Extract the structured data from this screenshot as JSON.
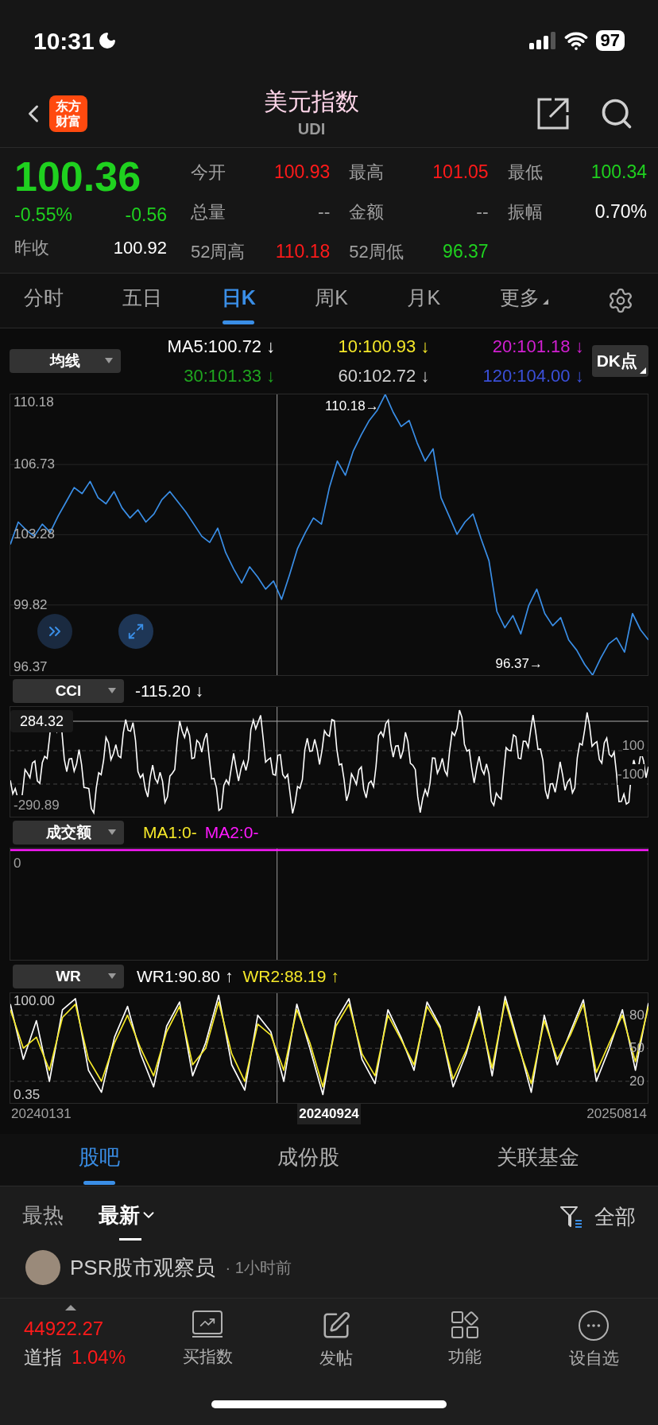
{
  "status_bar": {
    "time": "10:31",
    "battery": "97"
  },
  "nav": {
    "title": "美元指数",
    "code": "UDI",
    "logo": [
      "东方",
      "财富"
    ]
  },
  "quote": {
    "price": "100.36",
    "change_pct": "-0.55%",
    "change": "-0.56",
    "prev_close_label": "昨收",
    "prev_close": "100.92",
    "stats": [
      {
        "label": "今开",
        "value": "100.93",
        "color": "#ff1a1a"
      },
      {
        "label": "最高",
        "value": "101.05",
        "color": "#ff1a1a"
      },
      {
        "label": "最低",
        "value": "100.34",
        "color": "#1fd11f"
      },
      {
        "label": "总量",
        "value": "--",
        "color": "#9a9a9a"
      },
      {
        "label": "金额",
        "value": "--",
        "color": "#9a9a9a"
      },
      {
        "label": "振幅",
        "value": "0.70%",
        "color": "#ffffff"
      },
      {
        "label": "52周高",
        "value": "110.18",
        "color": "#ff1a1a"
      },
      {
        "label": "52周低",
        "value": "96.37",
        "color": "#1fd11f"
      }
    ]
  },
  "period_tabs": [
    {
      "label": "分时",
      "selected": false,
      "kind": "tab"
    },
    {
      "label": "五日",
      "selected": false,
      "kind": "tab"
    },
    {
      "label": "日K",
      "selected": true,
      "kind": "tab"
    },
    {
      "label": "周K",
      "selected": false,
      "kind": "tab"
    },
    {
      "label": "月K",
      "selected": false,
      "kind": "tab"
    },
    {
      "label": "更多",
      "selected": false,
      "kind": "menu"
    }
  ],
  "ma_selector": "均线",
  "ma_values": [
    {
      "text": "MA5:100.72 ↓",
      "color": "#ffffff"
    },
    {
      "text": "10:100.93 ↓",
      "color": "#f5e829"
    },
    {
      "text": "20:101.18 ↓",
      "color": "#d21fd2"
    },
    {
      "text": "30:101.33 ↓",
      "color": "#1fa51f"
    },
    {
      "text": "60:102.72 ↓",
      "color": "#d0d0d0"
    },
    {
      "text": "120:104.00 ↓",
      "color": "#3a4fd8"
    }
  ],
  "dk_button": "DK点",
  "price_chart": {
    "high_marker": "110.18→",
    "low_marker": "96.37→",
    "chart_data": {
      "type": "line",
      "grid": true,
      "ylim": [
        96.37,
        110.18
      ],
      "yticks": [
        {
          "value": 110.18,
          "label": "110.18"
        },
        {
          "value": 106.73,
          "label": "106.73"
        },
        {
          "value": 103.28,
          "label": "103.28"
        },
        {
          "value": 99.82,
          "label": "99.82"
        },
        {
          "value": 96.37,
          "label": "96.37"
        }
      ],
      "series": [
        {
          "color": "#3a8ee6",
          "values": [
            102.8,
            103.9,
            103.5,
            103.2,
            103.8,
            103.4,
            104.2,
            104.9,
            105.6,
            105.3,
            105.9,
            105.1,
            104.8,
            105.4,
            104.6,
            104.1,
            104.5,
            103.9,
            104.3,
            105.0,
            105.4,
            104.9,
            104.4,
            103.8,
            103.2,
            102.9,
            103.6,
            102.4,
            101.6,
            100.9,
            101.7,
            101.2,
            100.6,
            101.0,
            100.1,
            101.3,
            102.6,
            103.4,
            104.1,
            103.8,
            105.6,
            106.9,
            106.2,
            107.4,
            108.2,
            108.9,
            109.4,
            110.18,
            109.3,
            108.6,
            108.9,
            107.8,
            106.9,
            107.5,
            105.1,
            104.2,
            103.3,
            103.9,
            104.3,
            103.1,
            102.0,
            99.5,
            98.7,
            99.3,
            98.4,
            99.8,
            100.6,
            99.4,
            98.8,
            99.2,
            98.1,
            97.6,
            96.9,
            96.37,
            97.2,
            97.9,
            98.2,
            97.5,
            99.4,
            98.6,
            98.1
          ]
        }
      ]
    }
  },
  "cci": {
    "selector": "CCI",
    "value": "-115.20 ↓",
    "max_label": "284.32",
    "min_label": "-290.89",
    "right_labels": [
      "100",
      "-100"
    ]
  },
  "volume": {
    "selector": "成交额",
    "ma_values": [
      {
        "text": "MA1:0-",
        "color": "#f5e829"
      },
      {
        "text": "MA2:0-",
        "color": "#ff19ff"
      }
    ],
    "axis_label": "0"
  },
  "wr": {
    "selector": "WR",
    "values": [
      {
        "text": "WR1:90.80 ↑",
        "color": "#ffffff"
      },
      {
        "text": "WR2:88.19 ↑",
        "color": "#f5e829"
      }
    ],
    "max_label": "100.00",
    "min_label": "0.35",
    "chart_data": {
      "type": "line",
      "grid": true,
      "ylim": [
        0.35,
        100
      ],
      "yticks": [
        {
          "value": 80,
          "label": "80"
        },
        {
          "value": 50,
          "label": "50"
        },
        {
          "value": 20,
          "label": "20"
        }
      ],
      "series": [
        {
          "color": "#ffffff",
          "values": [
            90,
            40,
            75,
            20,
            85,
            95,
            30,
            10,
            60,
            88,
            45,
            15,
            70,
            92,
            25,
            55,
            98,
            35,
            12,
            80,
            65,
            20,
            90,
            50,
            8,
            75,
            95,
            40,
            18,
            85,
            60,
            30,
            92,
            70,
            15,
            45,
            88,
            25,
            97,
            55,
            10,
            80,
            35,
            65,
            94,
            20,
            50,
            85,
            30,
            91
          ]
        },
        {
          "color": "#f5e829",
          "values": [
            85,
            50,
            60,
            30,
            78,
            90,
            40,
            20,
            55,
            80,
            50,
            25,
            65,
            88,
            35,
            50,
            92,
            45,
            20,
            72,
            62,
            30,
            85,
            55,
            15,
            70,
            90,
            45,
            25,
            80,
            58,
            35,
            88,
            68,
            22,
            48,
            82,
            32,
            93,
            52,
            18,
            75,
            40,
            62,
            90,
            28,
            55,
            80,
            38,
            88
          ]
        }
      ]
    }
  },
  "dates": [
    {
      "text": "20240131",
      "selected": false
    },
    {
      "text": "20240924",
      "selected": true
    },
    {
      "text": "20250814",
      "selected": false
    }
  ],
  "section_tabs": [
    {
      "label": "股吧",
      "selected": true
    },
    {
      "label": "成份股",
      "selected": false
    },
    {
      "label": "关联基金",
      "selected": false
    }
  ],
  "sort_tabs": [
    {
      "label": "最热",
      "selected": false
    },
    {
      "label": "最新",
      "selected": true
    }
  ],
  "filter": "全部",
  "post": {
    "author": "PSR股市观察员",
    "time": "· 1小时前"
  },
  "bottom_bar": {
    "index_value": "44922.27",
    "index_name": "道指",
    "index_pct": "1.04%",
    "actions": [
      {
        "label": "买指数",
        "kind": "chart"
      },
      {
        "label": "发帖",
        "kind": "post"
      },
      {
        "label": "功能",
        "kind": "grid"
      },
      {
        "label": "设自选",
        "kind": "more"
      }
    ]
  }
}
